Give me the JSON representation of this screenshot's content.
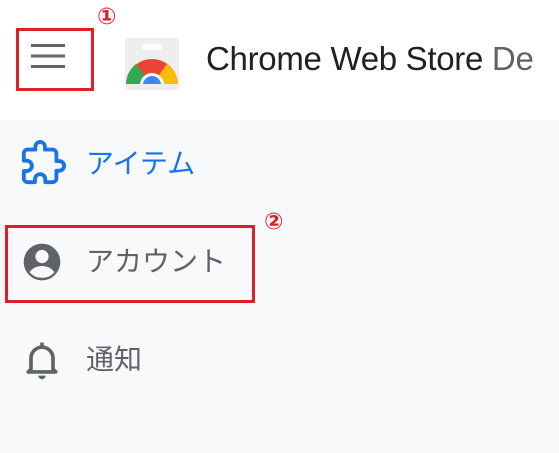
{
  "header": {
    "menu_icon": "hamburger-menu-icon",
    "logo_icon": "chrome-web-store-logo",
    "title": "Chrome Web Store",
    "title_suffix": "De"
  },
  "nav": {
    "items": [
      {
        "label": "アイテム",
        "icon": "puzzle-piece-icon",
        "active": true
      },
      {
        "label": "アカウント",
        "icon": "account-circle-icon",
        "active": false
      },
      {
        "label": "通知",
        "icon": "bell-icon",
        "active": false
      }
    ]
  },
  "annotations": [
    {
      "number": "①",
      "target": "menu-button"
    },
    {
      "number": "②",
      "target": "account-item"
    }
  ],
  "colors": {
    "accent_blue": "#1a73e8",
    "annotation_red": "#e01e2b",
    "text_gray": "#5f6368",
    "background": "#f8f9fa"
  }
}
